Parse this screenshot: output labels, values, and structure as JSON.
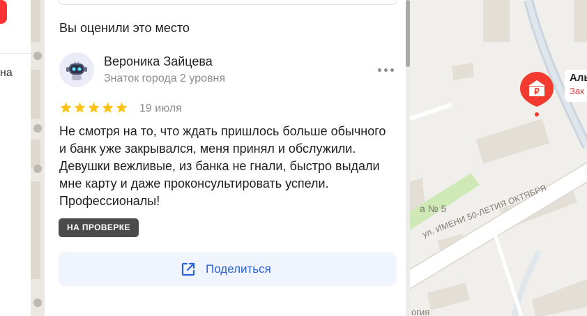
{
  "left_panel": {
    "text_fragment": "на"
  },
  "review": {
    "section_title": "Вы оценили это место",
    "author": {
      "name": "Вероника Зайцева",
      "level": "Знаток города 2 уровня"
    },
    "rating": 5,
    "date": "19 июля",
    "text": "Не смотря на то, что ждать пришлось больше обычного и банк уже закрывался, меня принял и обслужили. Девушки вежливые, из банка не гнали, быстро выдали мне карту и даже проконсультировать успели. Профессионалы!",
    "status_badge": "НА ПРОВЕРКЕ",
    "share_label": "Поделиться"
  },
  "map": {
    "place_name": "Аль",
    "place_status": "Зак",
    "street_label": "ул. ИМЕНИ 50-ЛЕТИЯ ОКТЯБРЯ",
    "area_label": "а № 5",
    "bottom_label": "огия"
  },
  "colors": {
    "star": "#fcc419",
    "accent_blue": "#2b62d9",
    "marker_red": "#f33a2e",
    "badge_bg": "#4b4b4b"
  }
}
